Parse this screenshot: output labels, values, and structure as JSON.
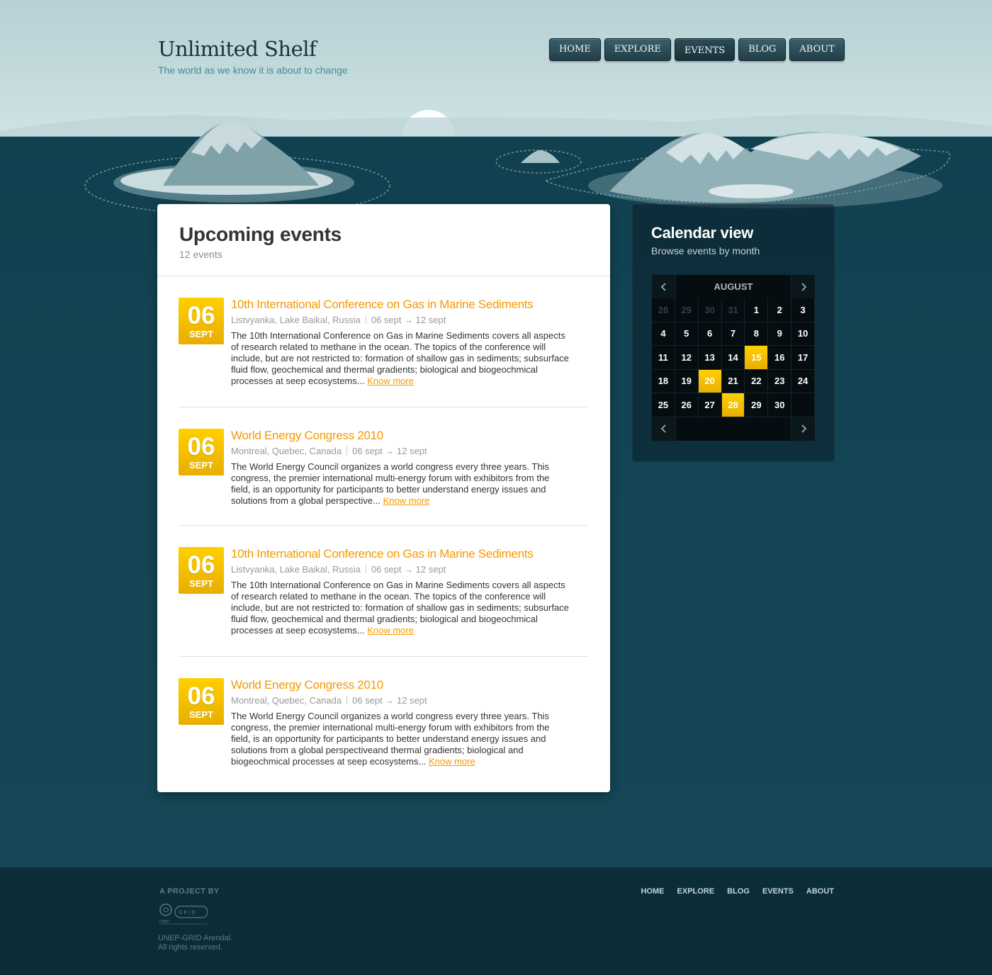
{
  "brand": {
    "title": "Unlimited Shelf",
    "tagline": "The world as we know it is about to change"
  },
  "topnav": [
    {
      "label": "HOME"
    },
    {
      "label": "EXPLORE"
    },
    {
      "label": "EVENTS",
      "active": true
    },
    {
      "label": "BLOG"
    },
    {
      "label": "ABOUT"
    }
  ],
  "events_panel": {
    "title": "Upcoming events",
    "count": "12 events"
  },
  "events": [
    {
      "day": "06",
      "month": "SEPT",
      "title": "10th International Conference on Gas in Marine Sediments",
      "location": "Listvyanka, Lake Baikal, Russia",
      "dates": "06 sept → 12 sept",
      "description": "The 10th International Conference on Gas in Marine Sediments covers all aspects of research related to methane in the ocean. The topics of the conference will include, but are not restricted to: formation of shallow gas in sediments; subsurface fluid flow, geochemical and thermal gradients; biological and biogeochmical processes at seep ecosystems...",
      "more": "Know more"
    },
    {
      "day": "06",
      "month": "SEPT",
      "title": "World Energy Congress 2010",
      "location": "Montreal, Quebec, Canada",
      "dates": "06 sept → 12 sept",
      "description": "The World Energy Council organizes a world congress every three years. This congress, the premier international multi-energy forum with exhibitors from the field, is an opportunity for participants to better understand energy issues and solutions from a global perspective...",
      "more": "Know more"
    },
    {
      "day": "06",
      "month": "SEPT",
      "title": "10th International Conference on Gas in Marine Sediments",
      "location": "Listvyanka, Lake Baikal, Russia",
      "dates": "06 sept → 12 sept",
      "description": "The 10th International Conference on Gas in Marine Sediments covers all aspects of research related to methane in the ocean. The topics of the conference will include, but are not restricted to: formation of shallow gas in sediments; subsurface fluid flow, geochemical and thermal gradients; biological and biogeochmical processes at seep ecosystems...",
      "more": "Know more"
    },
    {
      "day": "06",
      "month": "SEPT",
      "title": "World Energy Congress 2010",
      "location": "Montreal, Quebec, Canada",
      "dates": "06 sept → 12 sept",
      "description": "The World Energy Council organizes a world congress every three years. This congress, the premier international multi-energy forum with exhibitors from the field, is an opportunity for participants to better understand energy issues and solutions from a global perspectiveand thermal gradients; biological and biogeochmical processes at seep ecosystems...",
      "more": "Know more"
    }
  ],
  "calendar": {
    "title": "Calendar view",
    "subtitle": "Browse events by month",
    "month": "AUGUST",
    "prev_icon": "chevron-left-icon",
    "next_icon": "chevron-right-icon",
    "weeks": [
      [
        {
          "d": "28",
          "dim": true
        },
        {
          "d": "29",
          "dim": true
        },
        {
          "d": "30",
          "dim": true
        },
        {
          "d": "31",
          "dim": true
        },
        {
          "d": "1"
        },
        {
          "d": "2"
        },
        {
          "d": "3"
        }
      ],
      [
        {
          "d": "4"
        },
        {
          "d": "5"
        },
        {
          "d": "6"
        },
        {
          "d": "7"
        },
        {
          "d": "8"
        },
        {
          "d": "9"
        },
        {
          "d": "10"
        }
      ],
      [
        {
          "d": "11"
        },
        {
          "d": "12"
        },
        {
          "d": "13"
        },
        {
          "d": "14"
        },
        {
          "d": "15",
          "hl": true
        },
        {
          "d": "16"
        },
        {
          "d": "17"
        }
      ],
      [
        {
          "d": "18"
        },
        {
          "d": "19"
        },
        {
          "d": "20",
          "hl": true
        },
        {
          "d": "21"
        },
        {
          "d": "22"
        },
        {
          "d": "23"
        },
        {
          "d": "24"
        }
      ],
      [
        {
          "d": "25"
        },
        {
          "d": "26"
        },
        {
          "d": "27"
        },
        {
          "d": "28",
          "hl": true
        },
        {
          "d": "29"
        },
        {
          "d": "30"
        },
        {
          "d": ""
        }
      ]
    ],
    "accent": "#f5b800"
  },
  "footer": {
    "project_by": "A PROJECT BY",
    "logo_text": "UNEP GRID ARENDAL",
    "copyright_line1": "UNEP-GRID Arendal.",
    "copyright_line2": "All rights reserved.",
    "nav": [
      {
        "label": "HOME"
      },
      {
        "label": "EXPLORE"
      },
      {
        "label": "BLOG"
      },
      {
        "label": "EVENTS"
      },
      {
        "label": "ABOUT"
      }
    ]
  },
  "colors": {
    "accent": "#f59a00",
    "sea": "#124453",
    "sky": "#c4dadc"
  }
}
